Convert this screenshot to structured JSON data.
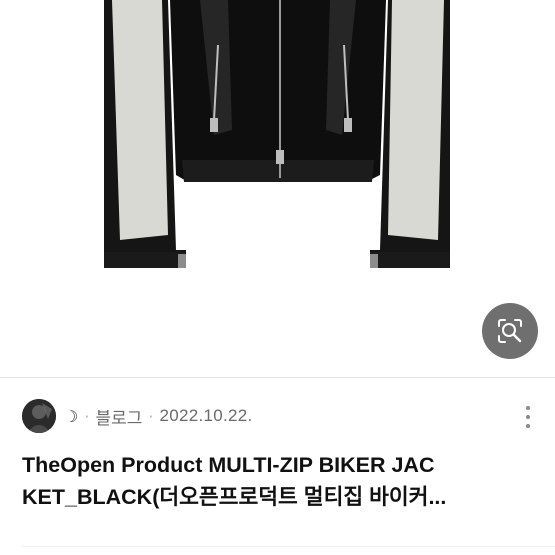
{
  "result": {
    "image": {
      "alt": "Black leather multi-zip biker jacket with cream side panels"
    },
    "lens_button": {
      "icon": "image-search-icon"
    },
    "author": {
      "avatar_icon": "avatar-image",
      "nickname": "☽"
    },
    "separator": "·",
    "source": "블로그",
    "date": "2022.10.22.",
    "more_icon": "more-vertical-icon",
    "title": {
      "line1": "TheOpen Product MULTI-ZIP BIKER JAC",
      "line2": "KET_BLACK(더오픈프로덕트 멀티집 바이커..."
    }
  }
}
